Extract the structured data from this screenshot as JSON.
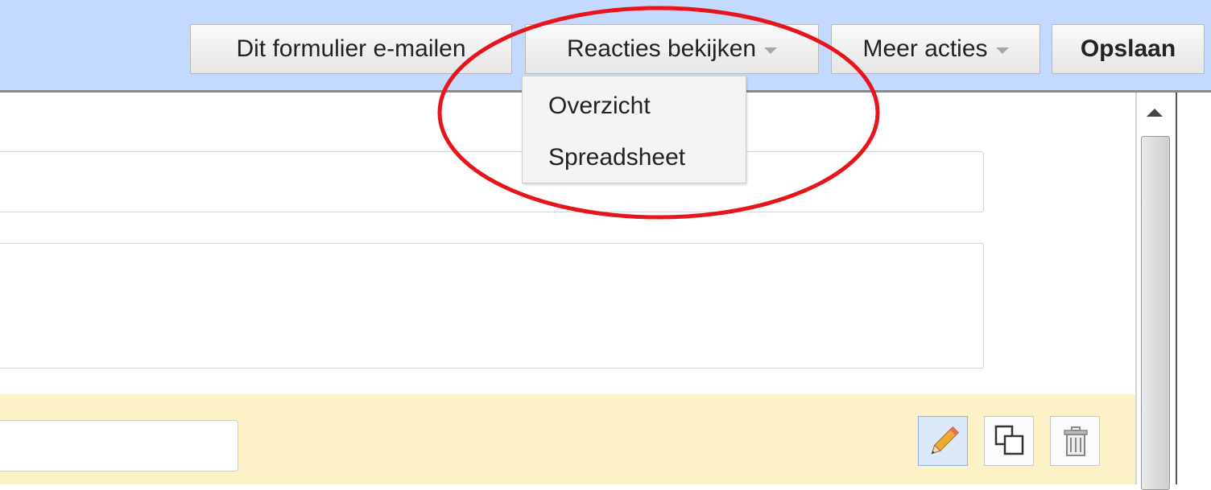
{
  "toolbar": {
    "email_label": "Dit formulier e-mailen",
    "responses_label": "Reacties bekijken",
    "more_label": "Meer acties",
    "save_label": "Opslaan"
  },
  "responses_menu": {
    "items": [
      {
        "label": "Overzicht"
      },
      {
        "label": "Spreadsheet"
      }
    ]
  },
  "item_actions": {
    "icons": [
      "pencil-icon",
      "duplicate-icon",
      "trash-icon"
    ]
  },
  "colors": {
    "toolbar_bg": "#c3d9ff",
    "highlight_panel": "#fdf1c7",
    "annotation": "#e8141c"
  }
}
